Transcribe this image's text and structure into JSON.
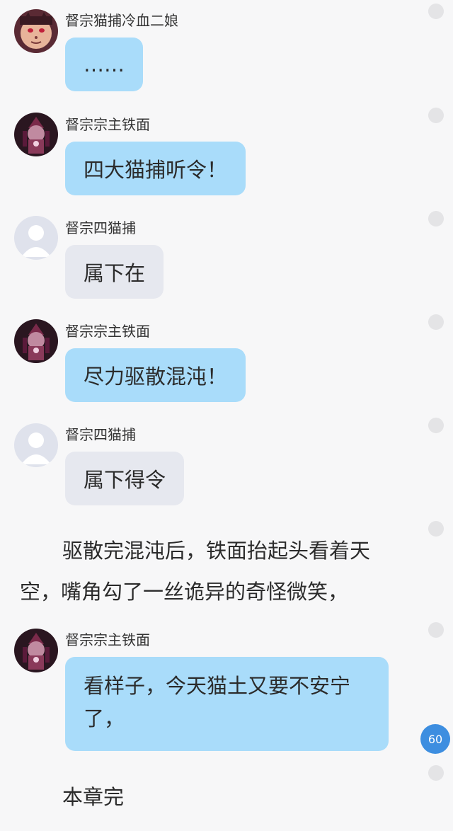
{
  "messages": [
    {
      "sender": "督宗猫捕冷血二娘",
      "text": "……"
    },
    {
      "sender": "督宗宗主铁面",
      "text": "四大猫捕听令！"
    },
    {
      "sender": "督宗四猫捕",
      "text": "属下在"
    },
    {
      "sender": "督宗宗主铁面",
      "text": "尽力驱散混沌！"
    },
    {
      "sender": "督宗四猫捕",
      "text": "属下得令"
    },
    {
      "sender": "督宗宗主铁面",
      "lines": [
        "看样子，今天猫土又要不安宁",
        "了，"
      ]
    }
  ],
  "narration": {
    "line1": "驱散完混沌后，铁面抬起头看着天",
    "line2": "空，嘴角勾了一丝诡异的奇怪微笑，"
  },
  "ending": "本章完",
  "badge": "60",
  "icons": {
    "avatar_erniang": "cat-avatar-icon",
    "avatar_tiemian": "character-avatar-icon",
    "avatar_default": "default-user-avatar-icon",
    "side_dot": "circle-icon"
  },
  "colors": {
    "bubble_blue": "#a9dcfa",
    "bubble_gray": "#e6e8ef",
    "badge": "#3d8ee0"
  }
}
